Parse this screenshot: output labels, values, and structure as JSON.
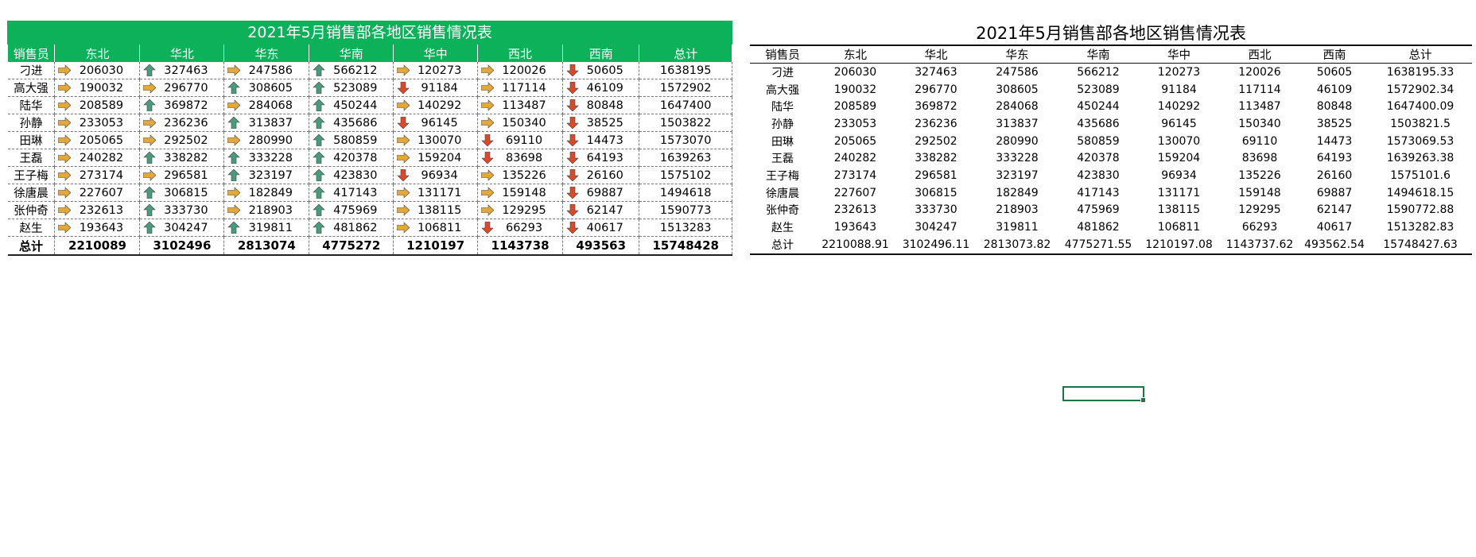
{
  "formatted_table": {
    "title": "2021年5月销售部各地区销售情况表",
    "headers": [
      "销售员",
      "东北",
      "华北",
      "华东",
      "华南",
      "华中",
      "西北",
      "西南",
      "总计"
    ],
    "rows": [
      {
        "name": "刁进",
        "values": [
          206030,
          327463,
          247586,
          566212,
          120273,
          120026,
          50605
        ],
        "icons": [
          "right",
          "up",
          "right",
          "up",
          "right",
          "right",
          "down"
        ],
        "total": "1638195"
      },
      {
        "name": "高大强",
        "values": [
          190032,
          296770,
          308605,
          523089,
          91184,
          117114,
          46109
        ],
        "icons": [
          "right",
          "right",
          "up",
          "up",
          "down",
          "right",
          "down"
        ],
        "total": "1572902"
      },
      {
        "name": "陆华",
        "values": [
          208589,
          369872,
          284068,
          450244,
          140292,
          113487,
          80848
        ],
        "icons": [
          "right",
          "up",
          "right",
          "up",
          "right",
          "right",
          "down"
        ],
        "total": "1647400"
      },
      {
        "name": "孙静",
        "values": [
          233053,
          236236,
          313837,
          435686,
          96145,
          150340,
          38525
        ],
        "icons": [
          "right",
          "right",
          "up",
          "up",
          "down",
          "right",
          "down"
        ],
        "total": "1503822"
      },
      {
        "name": "田琳",
        "values": [
          205065,
          292502,
          280990,
          580859,
          130070,
          69110,
          14473
        ],
        "icons": [
          "right",
          "right",
          "right",
          "up",
          "right",
          "down",
          "down"
        ],
        "total": "1573070"
      },
      {
        "name": "王磊",
        "values": [
          240282,
          338282,
          333228,
          420378,
          159204,
          83698,
          64193
        ],
        "icons": [
          "right",
          "up",
          "up",
          "up",
          "right",
          "down",
          "down"
        ],
        "total": "1639263"
      },
      {
        "name": "王子梅",
        "values": [
          273174,
          296581,
          323197,
          423830,
          96934,
          135226,
          26160
        ],
        "icons": [
          "right",
          "right",
          "up",
          "up",
          "down",
          "right",
          "down"
        ],
        "total": "1575102"
      },
      {
        "name": "徐唐晨",
        "values": [
          227607,
          306815,
          182849,
          417143,
          131171,
          159148,
          69887
        ],
        "icons": [
          "right",
          "up",
          "right",
          "up",
          "right",
          "right",
          "down"
        ],
        "total": "1494618"
      },
      {
        "name": "张仲奇",
        "values": [
          232613,
          333730,
          218903,
          475969,
          138115,
          129295,
          62147
        ],
        "icons": [
          "right",
          "up",
          "right",
          "up",
          "right",
          "right",
          "down"
        ],
        "total": "1590773"
      },
      {
        "name": "赵生",
        "values": [
          193643,
          304247,
          319811,
          481862,
          106811,
          66293,
          40617
        ],
        "icons": [
          "right",
          "up",
          "up",
          "up",
          "right",
          "down",
          "down"
        ],
        "total": "1513283"
      }
    ],
    "sum_row": [
      "总计",
      "2210089",
      "3102496",
      "2813074",
      "4775272",
      "1210197",
      "1143738",
      "493563",
      "15748428"
    ]
  },
  "plain_table": {
    "title": "2021年5月销售部各地区销售情况表",
    "headers": [
      "销售员",
      "东北",
      "华北",
      "华东",
      "华南",
      "华中",
      "西北",
      "西南",
      "总计"
    ],
    "rows": [
      [
        "刁进",
        "206030",
        "327463",
        "247586",
        "566212",
        "120273",
        "120026",
        "50605",
        "1638195.33"
      ],
      [
        "高大强",
        "190032",
        "296770",
        "308605",
        "523089",
        "91184",
        "117114",
        "46109",
        "1572902.34"
      ],
      [
        "陆华",
        "208589",
        "369872",
        "284068",
        "450244",
        "140292",
        "113487",
        "80848",
        "1647400.09"
      ],
      [
        "孙静",
        "233053",
        "236236",
        "313837",
        "435686",
        "96145",
        "150340",
        "38525",
        "1503821.5"
      ],
      [
        "田琳",
        "205065",
        "292502",
        "280990",
        "580859",
        "130070",
        "69110",
        "14473",
        "1573069.53"
      ],
      [
        "王磊",
        "240282",
        "338282",
        "333228",
        "420378",
        "159204",
        "83698",
        "64193",
        "1639263.38"
      ],
      [
        "王子梅",
        "273174",
        "296581",
        "323197",
        "423830",
        "96934",
        "135226",
        "26160",
        "1575101.6"
      ],
      [
        "徐唐晨",
        "227607",
        "306815",
        "182849",
        "417143",
        "131171",
        "159148",
        "69887",
        "1494618.15"
      ],
      [
        "张仲奇",
        "232613",
        "333730",
        "218903",
        "475969",
        "138115",
        "129295",
        "62147",
        "1590772.88"
      ],
      [
        "赵生",
        "193643",
        "304247",
        "319811",
        "481862",
        "106811",
        "66293",
        "40617",
        "1513282.83"
      ]
    ],
    "sum_row": [
      "总计",
      "2210088.91",
      "3102496.11",
      "2813073.82",
      "4775271.55",
      "1210197.08",
      "1143737.62",
      "493562.54",
      "15748427.63"
    ]
  },
  "colors": {
    "header_green": "#0cb15a",
    "arrow_up": "#4a9a7c",
    "arrow_right": "#e3a838",
    "arrow_down": "#d84a2a",
    "selection_border": "#217346"
  },
  "icon_names": {
    "up": "arrow-up-icon",
    "right": "arrow-right-icon",
    "down": "arrow-down-icon"
  }
}
